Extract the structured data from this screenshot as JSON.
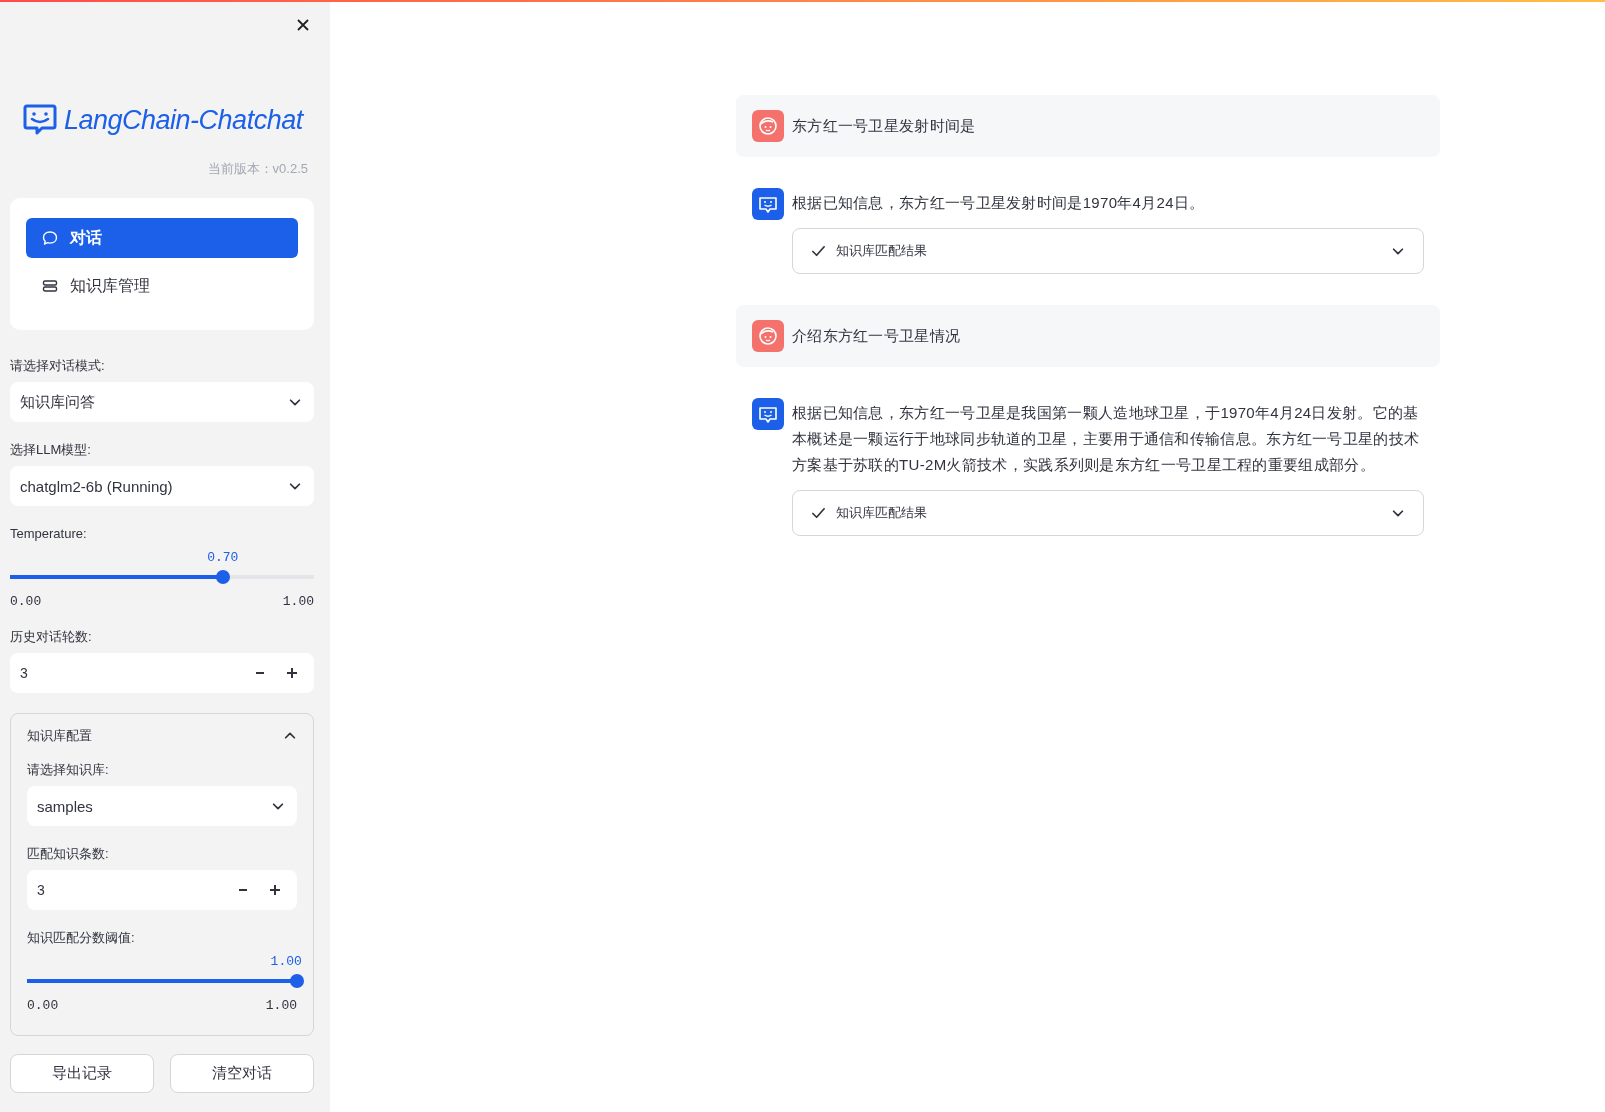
{
  "sidebar": {
    "logo": {
      "text": "LangChain-Chatchat"
    },
    "version": "当前版本：v0.2.5",
    "nav": [
      {
        "label": "对话",
        "selected": true
      },
      {
        "label": "知识库管理",
        "selected": false
      }
    ],
    "controls": [
      {
        "kind": "select",
        "label": "请选择对话模式:",
        "value": "知识库问答"
      },
      {
        "kind": "select",
        "label": "选择LLM模型:",
        "value": "chatglm2-6b (Running)"
      },
      {
        "kind": "slider",
        "label": "Temperature:",
        "reading": "0.70",
        "level": 0.7,
        "min": "0.00",
        "max": "1.00"
      },
      {
        "kind": "number",
        "label": "历史对话轮数:",
        "value": "3"
      }
    ],
    "expander": {
      "title": "知识库配置",
      "expanded": true,
      "controls": [
        {
          "kind": "select",
          "label": "请选择知识库:",
          "value": "samples"
        },
        {
          "kind": "number",
          "label": "匹配知识条数:",
          "value": "3"
        },
        {
          "kind": "slider",
          "label": "知识匹配分数阈值:",
          "reading": "1.00",
          "level": 1,
          "min": "0.00",
          "max": "1.00"
        }
      ]
    },
    "buttons": [
      "导出记录",
      "清空对话"
    ]
  },
  "messages": [
    {
      "kind": "user",
      "text": "东方红一号卫星发射时间是"
    },
    {
      "kind": "assistant",
      "text": "根据已知信息，东方红一号卫星发射时间是1970年4月24日。",
      "details": {
        "label": "知识库匹配结果",
        "expanded": false
      }
    },
    {
      "kind": "user",
      "text": "介绍东方红一号卫星情况"
    },
    {
      "kind": "assistant",
      "text": "根据已知信息，东方红一号卫星是我国第一颗人造地球卫星，于1970年4月24日发射。它的基本概述是一颗运行于地球同步轨道的卫星，主要用于通信和传输信息。东方红一号卫星的技术方案基于苏联的TU-2M火箭技术，实践系列则是东方红一号卫星工程的重要组成部分。",
      "details": {
        "label": "知识库匹配结果",
        "expanded": false
      }
    }
  ]
}
